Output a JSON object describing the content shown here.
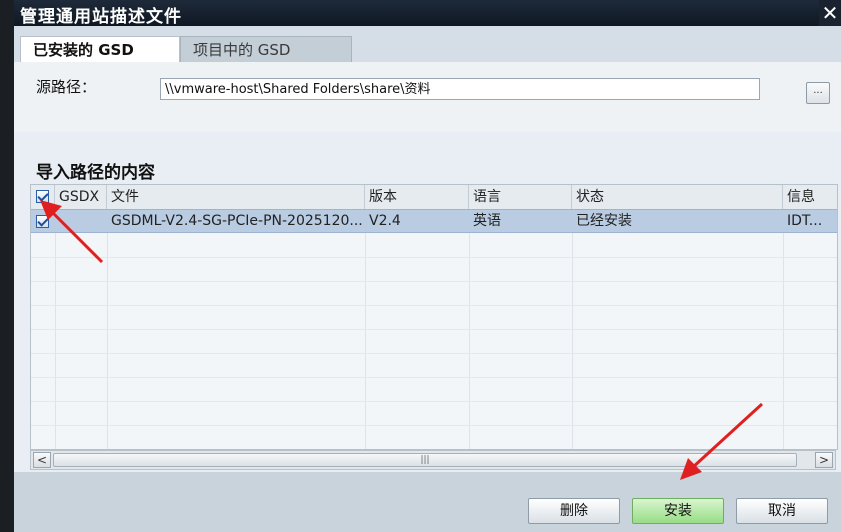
{
  "window": {
    "title": "管理通用站描述文件",
    "close_glyph": "✕"
  },
  "tabs": [
    {
      "label": "已安装的 GSD",
      "active": true
    },
    {
      "label": "项目中的 GSD",
      "active": false
    }
  ],
  "source": {
    "label": "源路径：",
    "path": "\\\\vmware-host\\Shared Folders\\share\\资料",
    "browse_label": "..."
  },
  "section_title": "导入路径的内容",
  "table": {
    "columns": [
      "GSDX",
      "文件",
      "版本",
      "语言",
      "状态",
      "信息"
    ],
    "rows": [
      {
        "checked": true,
        "file": "GSDML-V2.4-SG-PCIe-PN-2025120...",
        "version": "V2.4",
        "language": "英语",
        "status": "已经安装",
        "info": "IDT..."
      }
    ]
  },
  "scrollbar": {
    "left_glyph": "<",
    "right_glyph": ">",
    "thumb_glyph": "|||"
  },
  "buttons": {
    "delete": "删除",
    "install": "安装",
    "cancel": "取消"
  },
  "colors": {
    "title_bg": "#0f1722",
    "selected_row": "#b9cce2",
    "install_button": "#97dd86",
    "annotation_arrow": "#e02020"
  }
}
